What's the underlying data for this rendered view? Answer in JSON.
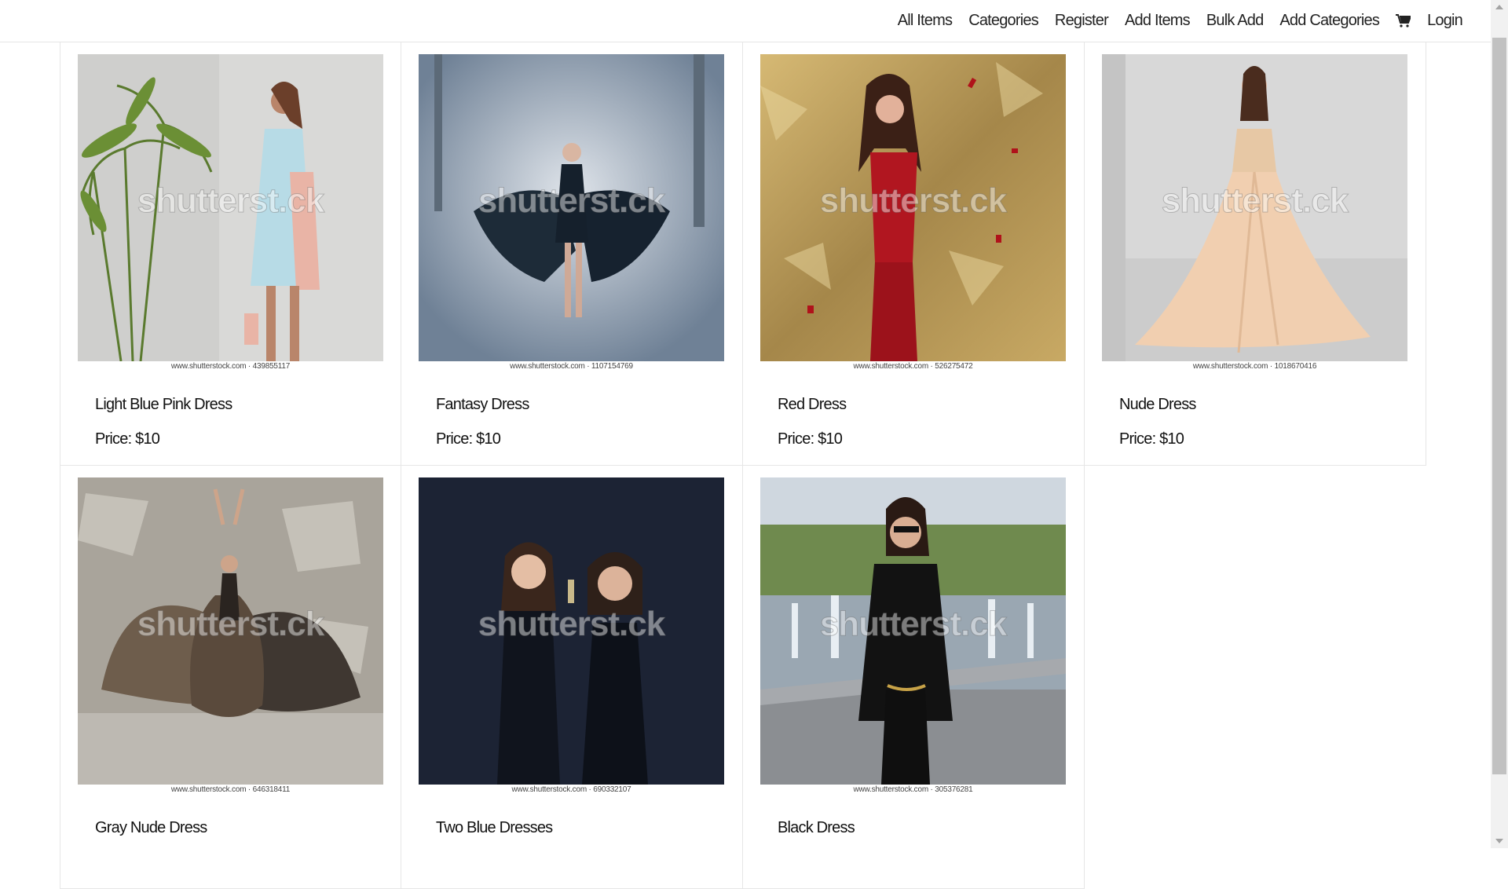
{
  "nav": {
    "links": [
      "All Items",
      "Categories",
      "Register",
      "Add Items",
      "Bulk Add",
      "Add Categories"
    ],
    "cart_icon": "shopping-cart-icon",
    "login": "Login"
  },
  "watermark": "shutterst.ck",
  "products": [
    {
      "title": "Light Blue Pink Dress",
      "price": "Price: $10",
      "credit": "www.shutterstock.com · 439855117"
    },
    {
      "title": "Fantasy Dress",
      "price": "Price: $10",
      "credit": "www.shutterstock.com · 1107154769"
    },
    {
      "title": "Red Dress",
      "price": "Price: $10",
      "credit": "www.shutterstock.com · 526275472"
    },
    {
      "title": "Nude Dress",
      "price": "Price: $10",
      "credit": "www.shutterstock.com · 1018670416"
    },
    {
      "title": "Gray Nude Dress",
      "price": "",
      "credit": "www.shutterstock.com · 646318411"
    },
    {
      "title": "Two Blue Dresses",
      "price": "",
      "credit": "www.shutterstock.com · 690332107"
    },
    {
      "title": "Black Dress",
      "price": "",
      "credit": "www.shutterstock.com · 305376281"
    }
  ]
}
